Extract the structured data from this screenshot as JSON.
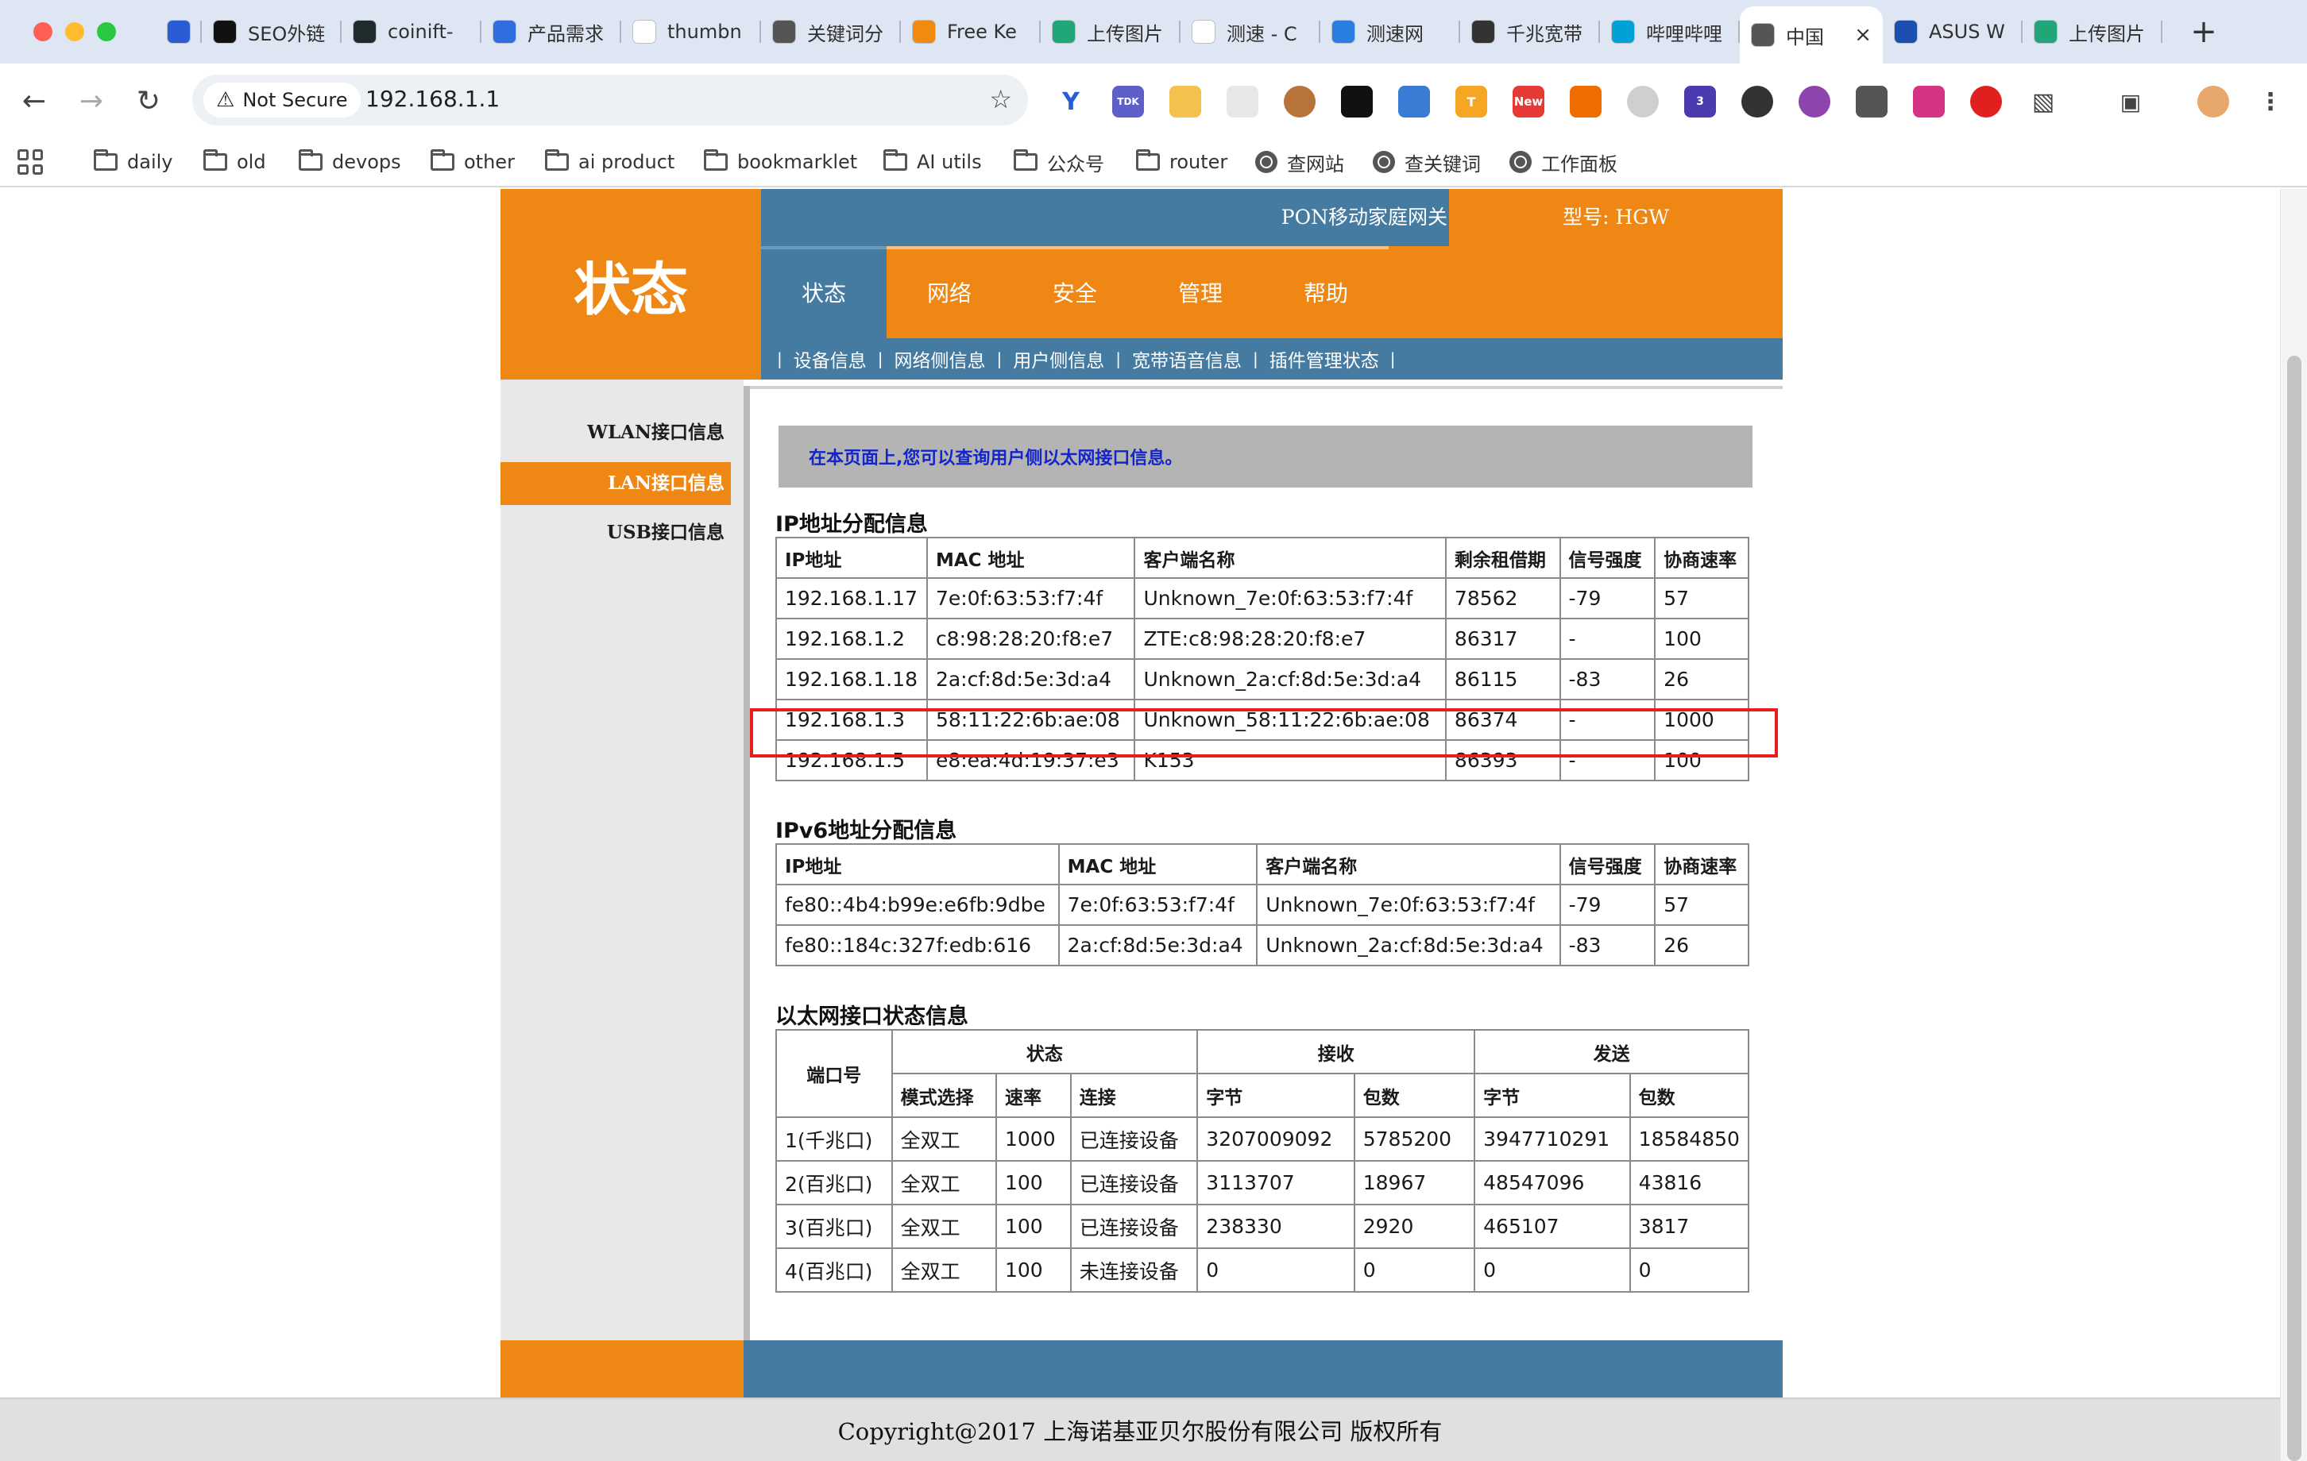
{
  "browser": {
    "tabs": [
      {
        "label": "",
        "icon": "vue-v-icon",
        "icon_color": "#2a5cd6"
      },
      {
        "label": "SEO外链",
        "icon": "triangle-icon",
        "icon_color": "#111111"
      },
      {
        "label": "coinift-",
        "icon": "bolt-icon",
        "icon_color": "#1f2b2d"
      },
      {
        "label": "产品需求",
        "icon": "doc-icon",
        "icon_color": "#2f6de1"
      },
      {
        "label": "thumbn",
        "icon": "google-g-icon",
        "icon_color": "#ffffff"
      },
      {
        "label": "关键词分",
        "icon": "globe-icon",
        "icon_color": "#555555"
      },
      {
        "label": "Free Ke",
        "icon": "a-logo-icon",
        "icon_color": "#f08a10"
      },
      {
        "label": "上传图片",
        "icon": "p-logo-icon",
        "icon_color": "#21a67a"
      },
      {
        "label": "测速 - C",
        "icon": "google-g-icon",
        "icon_color": "#ffffff"
      },
      {
        "label": "测速网",
        "icon": "s-logo-icon",
        "icon_color": "#2a7de1"
      },
      {
        "label": "千兆宽带",
        "icon": "openai-icon",
        "icon_color": "#333333"
      },
      {
        "label": "哔哩哔哩",
        "icon": "bilibili-icon",
        "icon_color": "#00a1d6"
      },
      {
        "label": "中国",
        "icon": "globe-icon",
        "icon_color": "#555555",
        "active": true
      },
      {
        "label": "ASUS W",
        "icon": "asus-a-icon",
        "icon_color": "#1a4fb0"
      },
      {
        "label": "上传图片",
        "icon": "p-logo-icon",
        "icon_color": "#21a67a"
      }
    ],
    "address": {
      "security": "Not Secure",
      "url": "192.168.1.1"
    },
    "bookmarks": [
      {
        "label": "daily",
        "type": "folder"
      },
      {
        "label": "old",
        "type": "folder"
      },
      {
        "label": "devops",
        "type": "folder"
      },
      {
        "label": "other",
        "type": "folder"
      },
      {
        "label": "ai product",
        "type": "folder"
      },
      {
        "label": "bookmarklet",
        "type": "folder"
      },
      {
        "label": "AI utils",
        "type": "folder"
      },
      {
        "label": "公众号",
        "type": "folder"
      },
      {
        "label": "router",
        "type": "folder"
      },
      {
        "label": "查网站",
        "type": "link"
      },
      {
        "label": "查关键词",
        "type": "link"
      },
      {
        "label": "工作面板",
        "type": "link"
      }
    ],
    "extensions": {
      "tdk_label": "TDK",
      "new_badge": "New",
      "count_badge": "3"
    }
  },
  "router": {
    "page_title": "状态",
    "product_name": "PON移动家庭网关",
    "model": "型号: HGW",
    "main_nav": [
      "状态",
      "网络",
      "安全",
      "管理",
      "帮助"
    ],
    "sub_nav": [
      "设备信息",
      "网络侧信息",
      "用户侧信息",
      "宽带语音信息",
      "插件管理状态"
    ],
    "sidebar": [
      "WLAN接口信息",
      "LAN接口信息",
      "USB接口信息"
    ],
    "info_text": "在本页面上,您可以查询用户侧以太网接口信息。",
    "ipv4": {
      "title": "IP地址分配信息",
      "headers": [
        "IP地址",
        "MAC 地址",
        "客户端名称",
        "剩余租借期",
        "信号强度",
        "协商速率"
      ],
      "rows": [
        [
          "192.168.1.17",
          "7e:0f:63:53:f7:4f",
          "Unknown_7e:0f:63:53:f7:4f",
          "78562",
          "-79",
          "57"
        ],
        [
          "192.168.1.2",
          "c8:98:28:20:f8:e7",
          "ZTE:c8:98:28:20:f8:e7",
          "86317",
          "-",
          "100"
        ],
        [
          "192.168.1.18",
          "2a:cf:8d:5e:3d:a4",
          "Unknown_2a:cf:8d:5e:3d:a4",
          "86115",
          "-83",
          "26"
        ],
        [
          "192.168.1.3",
          "58:11:22:6b:ae:08",
          "Unknown_58:11:22:6b:ae:08",
          "86374",
          "-",
          "1000"
        ],
        [
          "192.168.1.5",
          "e8:ea:4d:19:37:e3",
          "K153",
          "86393",
          "-",
          "100"
        ]
      ],
      "highlight_row": 3,
      "highlight_color": "#e81d1d"
    },
    "ipv6": {
      "title": "IPv6地址分配信息",
      "headers": [
        "IP地址",
        "MAC 地址",
        "客户端名称",
        "信号强度",
        "协商速率"
      ],
      "rows": [
        [
          "fe80::4b4:b99e:e6fb:9dbe",
          "7e:0f:63:53:f7:4f",
          "Unknown_7e:0f:63:53:f7:4f",
          "-79",
          "57"
        ],
        [
          "fe80::184c:327f:edb:616",
          "2a:cf:8d:5e:3d:a4",
          "Unknown_2a:cf:8d:5e:3d:a4",
          "-83",
          "26"
        ]
      ]
    },
    "ethernet": {
      "title": "以太网接口状态信息",
      "col_port": "端口号",
      "group_status": "状态",
      "group_rx": "接收",
      "group_tx": "发送",
      "sub_headers": [
        "模式选择",
        "速率",
        "连接",
        "字节",
        "包数",
        "字节",
        "包数"
      ],
      "rows": [
        [
          "1(千兆口)",
          "全双工",
          "1000",
          "已连接设备",
          "3207009092",
          "5785200",
          "3947710291",
          "18584850"
        ],
        [
          "2(百兆口)",
          "全双工",
          "100",
          "已连接设备",
          "3113707",
          "18967",
          "48547096",
          "43816"
        ],
        [
          "3(百兆口)",
          "全双工",
          "100",
          "已连接设备",
          "238330",
          "2920",
          "465107",
          "3817"
        ],
        [
          "4(百兆口)",
          "全双工",
          "100",
          "未连接设备",
          "0",
          "0",
          "0",
          "0"
        ]
      ]
    },
    "copyright": "Copyright@2017 上海诺基亚贝尔股份有限公司 版权所有",
    "colors": {
      "orange": "#ef8715",
      "blue": "#457ba0",
      "info_text": "#1325c8"
    }
  }
}
